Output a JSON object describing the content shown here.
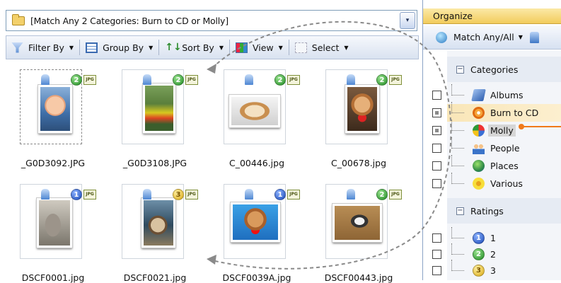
{
  "address_bar": {
    "text": "[Match Any 2 Categories: Burn to CD or Molly]",
    "dropdown_glyph": "▾"
  },
  "toolbar": {
    "filter_label": "Filter By",
    "group_label": "Group By",
    "sort_label": "Sort By",
    "view_label": "View",
    "select_label": "Select"
  },
  "thumbnails": [
    {
      "name": "_G0D3092.JPG",
      "rating": "2",
      "badge": "JPG"
    },
    {
      "name": "_G0D3108.JPG",
      "rating": "2",
      "badge": "JPG"
    },
    {
      "name": "C_00446.jpg",
      "rating": "2",
      "badge": "JPG"
    },
    {
      "name": "C_00678.jpg",
      "rating": "2",
      "badge": "JPG"
    },
    {
      "name": "DSCF0001.jpg",
      "rating": "1",
      "badge": "JPG"
    },
    {
      "name": "DSCF0021.jpg",
      "rating": "3",
      "badge": "JPG"
    },
    {
      "name": "DSCF0039A.jpg",
      "rating": "1",
      "badge": "JPG"
    },
    {
      "name": "DSCF00443.jpg",
      "rating": "2",
      "badge": "JPG"
    }
  ],
  "organize": {
    "header": "Organize",
    "match_label": "Match Any/All",
    "categories_title": "Categories",
    "categories": [
      {
        "label": "Albums",
        "icon": "albums-icon"
      },
      {
        "label": "Burn to CD",
        "icon": "burn-cd-icon"
      },
      {
        "label": "Molly",
        "icon": "molly-icon"
      },
      {
        "label": "People",
        "icon": "people-icon"
      },
      {
        "label": "Places",
        "icon": "places-icon"
      },
      {
        "label": "Various",
        "icon": "various-icon"
      }
    ],
    "ratings_title": "Ratings",
    "ratings": [
      "1",
      "2",
      "3"
    ]
  },
  "colors": {
    "accent_orange": "#f07a1a",
    "header_gold": "#f2cc5d",
    "rating1": "#1747b7",
    "rating2": "#1f8a22",
    "rating3": "#d9a814"
  }
}
